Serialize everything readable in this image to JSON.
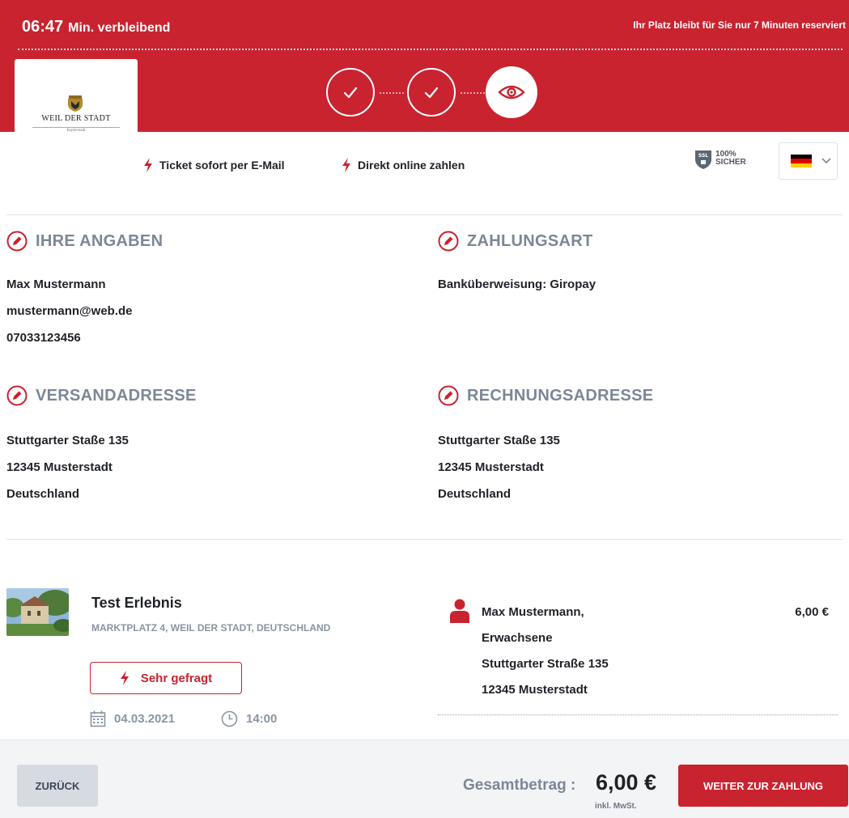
{
  "header": {
    "timer": "06:47",
    "timer_label": "Min. verbleibend",
    "reserve_notice": "Ihr Platz bleibt für Sie nur 7 Minuten reserviert",
    "logo_text": "WEIL DER STADT",
    "logo_subtext": "Keplerstadt",
    "steps": [
      {
        "state": "done",
        "icon": "check-icon"
      },
      {
        "state": "done",
        "icon": "check-icon"
      },
      {
        "state": "active",
        "icon": "eye-icon"
      }
    ]
  },
  "features": {
    "email": "Ticket sofort per E-Mail",
    "online": "Direkt online zahlen",
    "ssl_badge": "SSL",
    "ssl_percent": "100%",
    "ssl_text": "SICHER",
    "language": "de"
  },
  "details": {
    "personal": {
      "title": "IHRE ANGABEN",
      "lines": [
        "Max Mustermann",
        "mustermann@web.de",
        "07033123456"
      ]
    },
    "payment": {
      "title": "ZAHLUNGSART",
      "lines": [
        "Banküberweisung: Giropay"
      ]
    },
    "shipping": {
      "title": "VERSANDADRESSE",
      "lines": [
        "Stuttgarter Staße 135",
        "12345 Musterstadt",
        "Deutschland"
      ]
    },
    "billing": {
      "title": "RECHNUNGSADRESSE",
      "lines": [
        "Stuttgarter Staße 135",
        "12345 Musterstadt",
        "Deutschland"
      ]
    }
  },
  "event": {
    "title": "Test Erlebnis",
    "address": "MARKTPLATZ 4, WEIL DER STADT, DEUTSCHLAND",
    "badge": "Sehr gefragt",
    "date": "04.03.2021",
    "time": "14:00",
    "ticket": {
      "name": "Max Mustermann,",
      "category": "Erwachsene",
      "street": "Stuttgarter Straße 135",
      "city": "12345 Musterstadt",
      "price": "6,00 €"
    }
  },
  "footer": {
    "back_label": "ZURÜCK",
    "total_label": "Gesamtbetrag :",
    "total_value": "6,00 €",
    "vat_note": "inkl. MwSt.",
    "pay_label": "WEITER ZUR ZAHLUNG"
  },
  "colors": {
    "brand_red": "#c9232f",
    "heading_grey": "#7c8796",
    "text_dark": "#1f2227"
  }
}
